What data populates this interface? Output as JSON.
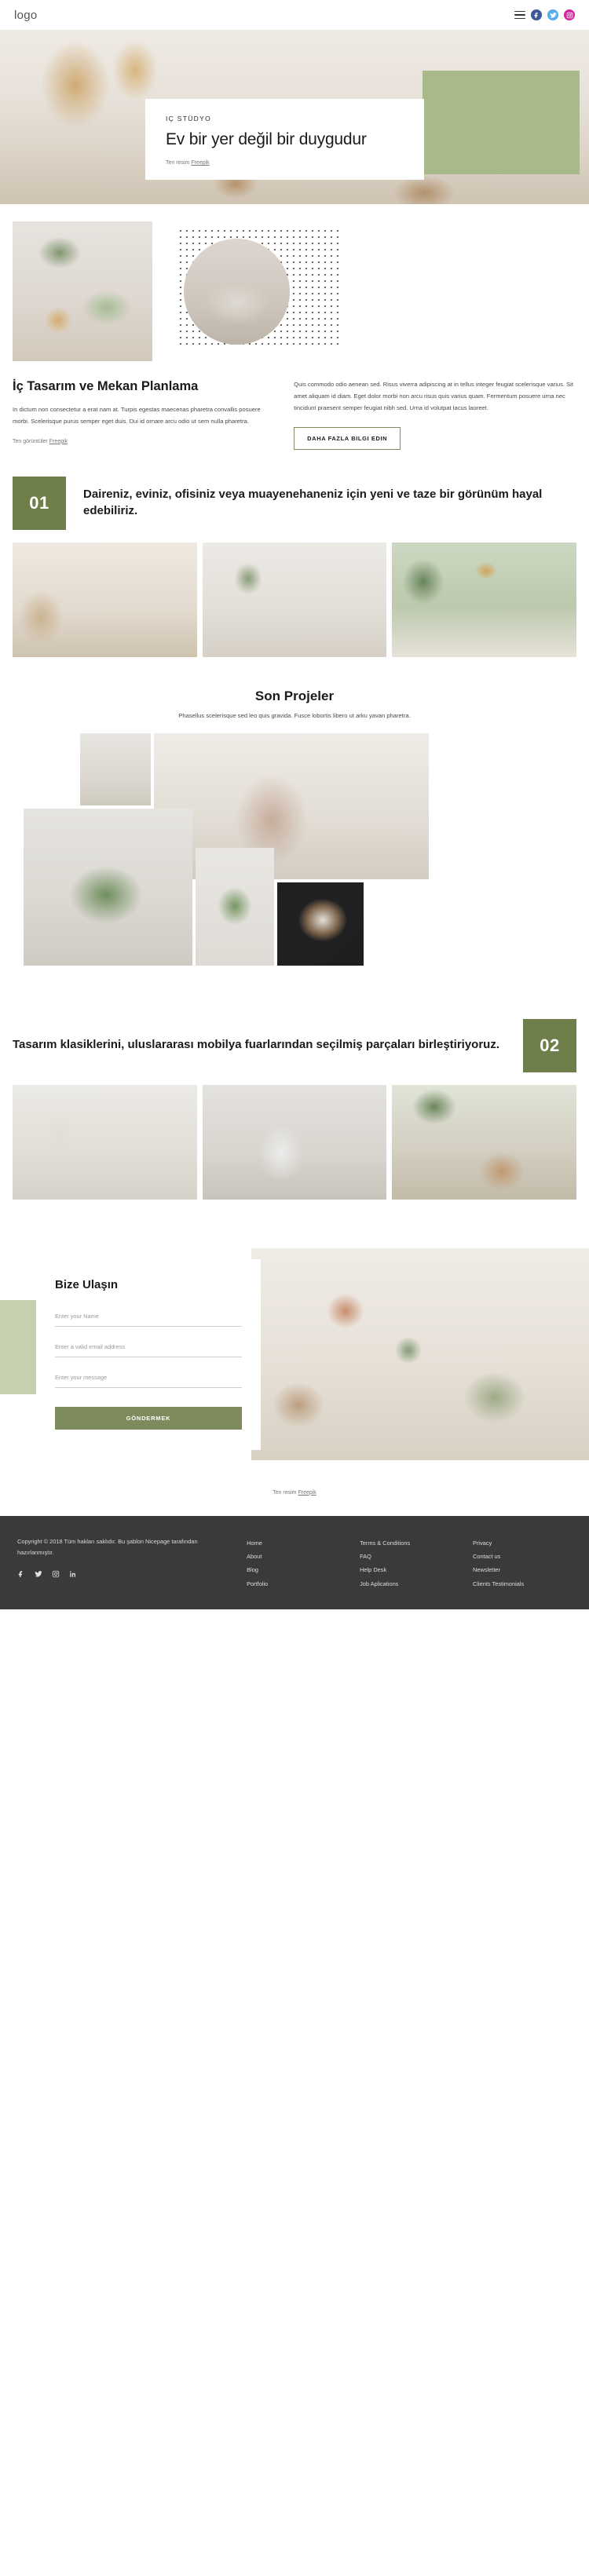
{
  "header": {
    "logo": "logo",
    "menu_icon": "hamburger-menu-icon",
    "social": [
      {
        "name": "facebook",
        "glyph": "f",
        "color": "#3b5998"
      },
      {
        "name": "twitter",
        "glyph": "t",
        "color": "#55acee"
      },
      {
        "name": "instagram",
        "glyph": "o",
        "color": "#d6249f"
      }
    ]
  },
  "hero": {
    "eyebrow": "IÇ STÜDYO",
    "title": "Ev bir yer değil bir duygudur",
    "credit_prefix": "Ten resim ",
    "credit_link": "Freepik",
    "accent_color": "#a8b98a"
  },
  "about": {
    "heading": "İç Tasarım ve Mekan Planlama",
    "paragraph_left": "In dictum non consectetur a erat nam at. Turpis egestas maecenas pharetra convallis posuere morbi. Scelerisque purus semper eget duis. Dui id ornare arcu odio ut sem nulla pharetra.",
    "paragraph_right": "Quis commodo odio aenean sed. Risus viverra adipiscing at in tellus integer feugiat scelerisque varius. Sit amet aliquam id diam. Eget dolor morbi non arcu risus quis varius quam. Fermentum posuere urna nec tincidunt praesent semper feugiat nibh sed. Urna id volutpat lacus laoreet.",
    "button": "DAHA FAZLA BILGI EDIN",
    "credit_prefix": "Ten görüntüler ",
    "credit_link": "Freepik"
  },
  "block_one": {
    "number": "01",
    "title": "Daireniz, eviniz, ofisiniz veya muayenehaneniz için yeni ve taze bir görünüm hayal edebiliriz.",
    "accent_color": "#6e7f49"
  },
  "projects": {
    "heading": "Son Projeler",
    "subtitle": "Phasellus scelerisque sed leo quis gravida. Fusce lobortis libero ut arku yavan pharetra."
  },
  "block_two": {
    "number": "02",
    "title": "Tasarım klasiklerini, uluslararası mobilya fuarlarından seçilmiş parçaları birleştiriyoruz.",
    "accent_color": "#6e7f49"
  },
  "contact": {
    "title": "Bize Ulaşın",
    "name_placeholder": "Enter your Name",
    "email_placeholder": "Enter a valid email address",
    "message_placeholder": "Enter your message",
    "name_value": "",
    "email_value": "",
    "message_value": "",
    "submit": "GÖNDERMEK",
    "credit_prefix": "Ten resim ",
    "credit_link": "Freepik",
    "band_color": "#c5d0ae",
    "button_color": "#7d8a5c"
  },
  "footer": {
    "copyright": "Copyright © 2018 Tüm hakları saklıdır. Bu şablon Nicepage tarafından hazırlanmıştır.",
    "columns": [
      {
        "links": [
          "Home",
          "About",
          "Blog",
          "Portfolio"
        ]
      },
      {
        "links": [
          "Terms & Conditions",
          "FAQ",
          "Help Desk",
          "Job Aplications"
        ]
      },
      {
        "links": [
          "Privacy",
          "Contact us",
          "Newsletter",
          "Clients Testimonials"
        ]
      }
    ],
    "social": [
      "facebook",
      "twitter",
      "instagram",
      "linkedin"
    ],
    "background": "#3a3a3a"
  }
}
